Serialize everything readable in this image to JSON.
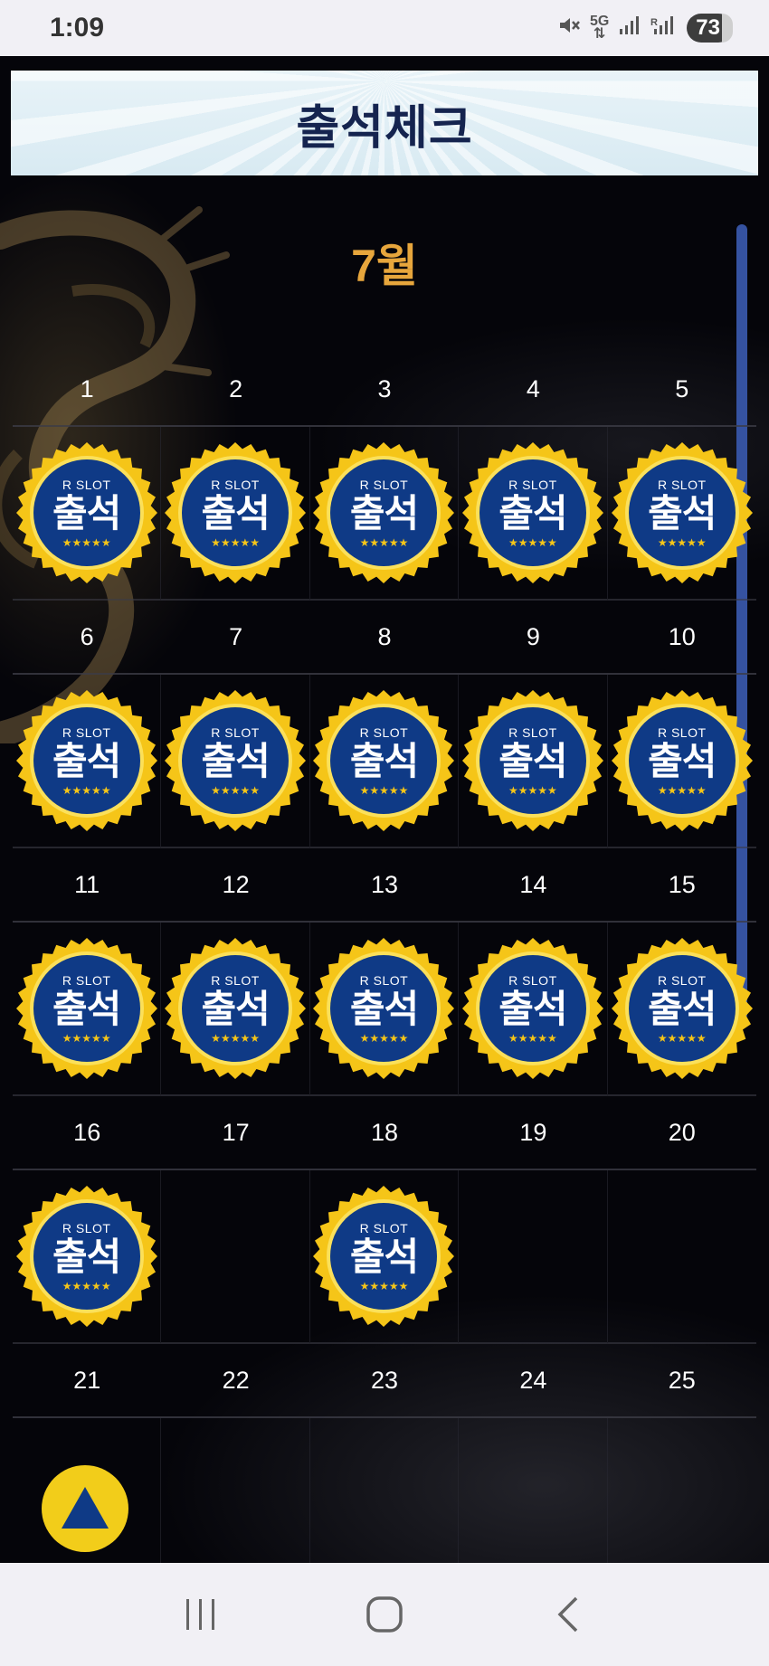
{
  "status_bar": {
    "time": "1:09",
    "network": "5G",
    "battery": "73"
  },
  "header": {
    "title": "출석체크"
  },
  "calendar": {
    "month": "7월",
    "badge": {
      "brand": "R SLOT",
      "word": "출석",
      "stars": "★★★★★"
    },
    "weeks": [
      {
        "days": [
          "1",
          "2",
          "3",
          "4",
          "5"
        ],
        "checked": [
          true,
          true,
          true,
          true,
          true
        ]
      },
      {
        "days": [
          "6",
          "7",
          "8",
          "9",
          "10"
        ],
        "checked": [
          true,
          true,
          true,
          true,
          true
        ]
      },
      {
        "days": [
          "11",
          "12",
          "13",
          "14",
          "15"
        ],
        "checked": [
          true,
          true,
          true,
          true,
          true
        ]
      },
      {
        "days": [
          "16",
          "17",
          "18",
          "19",
          "20"
        ],
        "checked": [
          true,
          false,
          true,
          false,
          false
        ]
      },
      {
        "days": [
          "21",
          "22",
          "23",
          "24",
          "25"
        ],
        "checked": [
          false,
          false,
          false,
          false,
          false
        ]
      }
    ]
  },
  "colors": {
    "title": "#15244f",
    "month": "#e7a63c",
    "badge_fill": "#0f3a86",
    "badge_ring": "#f5c518",
    "fab": "#f2cd1a"
  },
  "icons": {
    "fab": "scroll-top-icon",
    "nav": [
      "recent-apps-icon",
      "home-icon",
      "back-icon"
    ]
  }
}
